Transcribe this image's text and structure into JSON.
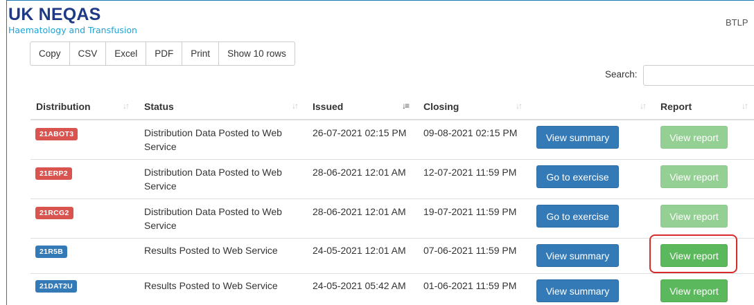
{
  "brand": {
    "title": "UK NEQAS",
    "subtitle": "Haematology and Transfusion"
  },
  "user": "BTLP",
  "toolbar": {
    "buttons": [
      "Copy",
      "CSV",
      "Excel",
      "PDF",
      "Print",
      "Show 10 rows"
    ]
  },
  "search": {
    "label": "Search:",
    "value": ""
  },
  "table": {
    "headers": [
      "Distribution",
      "Status",
      "Issued",
      "Closing",
      "",
      "Report"
    ],
    "sorted_column": "Issued",
    "rows": [
      {
        "distribution": "21ABOT3",
        "badge_color": "#d9534f",
        "status": "Distribution Data Posted to Web Service",
        "issued": "26-07-2021 02:15 PM",
        "closing": "09-08-2021 02:15 PM",
        "action": "View summary",
        "report": "View report",
        "report_enabled": false
      },
      {
        "distribution": "21ERP2",
        "badge_color": "#d9534f",
        "status": "Distribution Data Posted to Web Service",
        "issued": "28-06-2021 12:01 AM",
        "closing": "12-07-2021 11:59 PM",
        "action": "Go to exercise",
        "report": "View report",
        "report_enabled": false
      },
      {
        "distribution": "21RCG2",
        "badge_color": "#d9534f",
        "status": "Distribution Data Posted to Web Service",
        "issued": "28-06-2021 12:01 AM",
        "closing": "19-07-2021 11:59 PM",
        "action": "Go to exercise",
        "report": "View report",
        "report_enabled": false
      },
      {
        "distribution": "21R5B",
        "badge_color": "#337ab7",
        "status": "Results Posted to Web Service",
        "issued": "24-05-2021 12:01 AM",
        "closing": "07-06-2021 11:59 PM",
        "action": "View summary",
        "report": "View report",
        "report_enabled": true
      },
      {
        "distribution": "21DAT2U",
        "badge_color": "#337ab7",
        "status": "Results Posted to Web Service",
        "issued": "24-05-2021 05:42 AM",
        "closing": "01-06-2021 11:59 PM",
        "action": "View summary",
        "report": "View report",
        "report_enabled": true
      }
    ]
  },
  "colors": {
    "brand_navy": "#1f3a85",
    "brand_cyan": "#1ea3d6",
    "primary": "#337ab7",
    "success": "#5cb85c",
    "danger": "#d9534f",
    "highlight": "#d62b2b"
  }
}
